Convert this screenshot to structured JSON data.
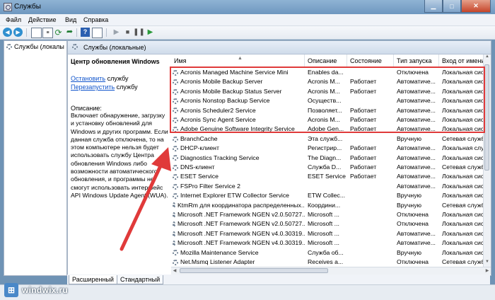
{
  "window": {
    "title": "Службы"
  },
  "menu": [
    "Файл",
    "Действие",
    "Вид",
    "Справка"
  ],
  "tree": {
    "root": "Службы (локалы"
  },
  "pane": {
    "header": "Службы (локальные)"
  },
  "description": {
    "service_title": "Центр обновления Windows",
    "stop_link": "Остановить",
    "stop_suffix": " службу",
    "restart_link": "Перезапустить",
    "restart_suffix": " службу",
    "desc_label": "Описание:",
    "desc_text": "Включает обнаружение, загрузку и установку обновлений для Windows и других программ. Если данная служба отключена, то на этом компьютере нельзя будет использовать службу Центра обновления Windows либо возможности автоматического обновления, и программы не смогут использовать интерфейс API Windows Update Agent (WUA)."
  },
  "columns": [
    "Имя",
    "Описание",
    "Состояние",
    "Тип запуска",
    "Вход от имени"
  ],
  "rows": [
    [
      "Acronis Managed Machine Service Mini",
      "Enables da...",
      "",
      "Отключена",
      "Локальная сис"
    ],
    [
      "Acronis Mobile Backup Server",
      "Acronis M...",
      "Работает",
      "Автоматиче...",
      "Локальная сис"
    ],
    [
      "Acronis Mobile Backup Status Server",
      "Acronis M...",
      "Работает",
      "Автоматиче...",
      "Локальная сис"
    ],
    [
      "Acronis Nonstop Backup Service",
      "Осуществ...",
      "",
      "Автоматиче...",
      "Локальная сис"
    ],
    [
      "Acronis Scheduler2 Service",
      "Позволяет...",
      "Работает",
      "Автоматиче...",
      "Локальная сис"
    ],
    [
      "Acronis Sync Agent Service",
      "Acronis M...",
      "Работает",
      "Автоматиче...",
      "Локальная сис"
    ],
    [
      "Adobe Genuine Software Integrity Service",
      "Adobe Gen...",
      "Работает",
      "Автоматиче...",
      "Локальная сис"
    ],
    [
      "BranchCache",
      "Эта служб...",
      "",
      "Вручную",
      "Сетевая служб"
    ],
    [
      "DHCP-клиент",
      "Регистрир...",
      "Работает",
      "Автоматиче...",
      "Локальная слу"
    ],
    [
      "Diagnostics Tracking Service",
      "The Diagn...",
      "Работает",
      "Автоматиче...",
      "Локальная сис"
    ],
    [
      "DNS-клиент",
      "Служба D...",
      "Работает",
      "Автоматиче...",
      "Сетевая служб"
    ],
    [
      "ESET Service",
      "ESET Service",
      "Работает",
      "Автоматиче...",
      "Локальная сис"
    ],
    [
      "FSPro Filter Service 2",
      "",
      "",
      "Автоматиче...",
      "Локальная сис"
    ],
    [
      "Internet Explorer ETW Collector Service",
      "ETW Collec...",
      "",
      "Вручную",
      "Локальная сис"
    ],
    [
      "KtmRm для координатора распределенных...",
      "Координи...",
      "",
      "Вручную",
      "Сетевая служб"
    ],
    [
      "Microsoft .NET Framework NGEN v2.0.50727...",
      "Microsoft ...",
      "",
      "Отключена",
      "Локальная сис"
    ],
    [
      "Microsoft .NET Framework NGEN v2.0.50727...",
      "Microsoft ...",
      "",
      "Отключена",
      "Локальная сис"
    ],
    [
      "Microsoft .NET Framework NGEN v4.0.30319...",
      "Microsoft ...",
      "",
      "Автоматиче...",
      "Локальная сис"
    ],
    [
      "Microsoft .NET Framework NGEN v4.0.30319...",
      "Microsoft ...",
      "",
      "Автоматиче...",
      "Локальная сис"
    ],
    [
      "Mozilla Maintenance Service",
      "Служба об...",
      "",
      "Вручную",
      "Локальная сис"
    ],
    [
      "Net.Msmq Listener Adapter",
      "Receives a...",
      "",
      "Отключена",
      "Сетевая служб"
    ]
  ],
  "tabs": [
    "Расширенный",
    "Стандартный"
  ],
  "watermark": "windwix.ru",
  "colors": {
    "highlight": "#e03a3a",
    "arrow": "#e03a3a",
    "link": "#1155cc"
  }
}
